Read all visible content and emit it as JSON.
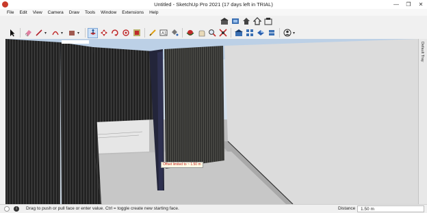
{
  "window": {
    "title": "Untitled - SketchUp Pro 2021 (17 days left in TRIAL)",
    "minimize": "—",
    "maximize": "❐",
    "close": "✕"
  },
  "menu": [
    "File",
    "Edit",
    "View",
    "Camera",
    "Draw",
    "Tools",
    "Window",
    "Extensions",
    "Help"
  ],
  "toolbar_top": {
    "icons": [
      "warehouse-icon",
      "component-icon",
      "share-icon",
      "extension-warehouse-icon",
      "layout-icon"
    ]
  },
  "toolbar_main": {
    "icons": [
      "select-icon",
      "eraser-icon",
      "line-icon",
      "arc-icon",
      "shape-icon",
      "push-pull-icon",
      "move-icon",
      "rotate-icon",
      "scale-icon",
      "offset-icon",
      "tape-measure-icon",
      "text-icon",
      "paint-bucket-icon",
      "orbit-icon",
      "pan-icon",
      "zoom-icon",
      "zoom-extents-icon",
      "warehouse-icon",
      "extension-icon",
      "styles-icon",
      "section-icon",
      "account-icon"
    ]
  },
  "viewport": {
    "tooltip": "Offset limited to ~ 1.50 m"
  },
  "tray": {
    "label": "Default Tray"
  },
  "status": {
    "hint": "Drag to push or pull face or enter value.  Ctrl = toggle create new starting face.",
    "measure_label": "Distance",
    "measure_value": "1.50 m"
  },
  "colors": {
    "accent": "#cfe2f7",
    "tooltip_text": "#c01818"
  }
}
